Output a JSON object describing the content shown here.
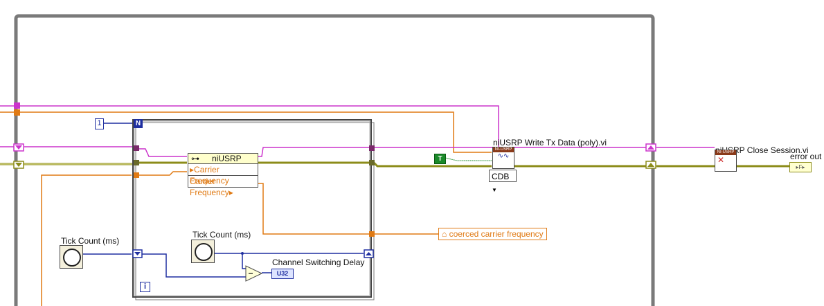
{
  "diagram": {
    "outer_loop_count": "1",
    "for_loop_count_terminal": "N",
    "while_loop_iteration_terminal": "i"
  },
  "property_node": {
    "class_name": "niUSRP",
    "rows": [
      "Carrier Frequency",
      "Carrier Frequency"
    ]
  },
  "labels": {
    "tick_count_1": "Tick Count (ms)",
    "tick_count_2": "Tick Count (ms)",
    "write_tx": "niUSRP Write Tx Data (poly).vi",
    "close_session": "niUSRP Close Session.vi",
    "error_out": "error out",
    "channel_switching_delay": "Channel Switching Delay"
  },
  "indicators": {
    "coerced_carrier_frequency": "coerced carrier frequency",
    "channel_switching_delay_type": "U32",
    "error_out_icon": "▸F▸"
  },
  "controls": {
    "boolean_true": "T",
    "write_tx_mode": "CDB"
  },
  "vi_icons": {
    "write_tx_header": "NI-USRP",
    "close_header": "NI-USRP"
  },
  "colors": {
    "wire_pink": "#cc33cc",
    "wire_orange": "#e07a14",
    "wire_error": "#8c8c1a",
    "wire_blue": "#1f2fa0",
    "frame_gray": "#7a7a7a"
  }
}
